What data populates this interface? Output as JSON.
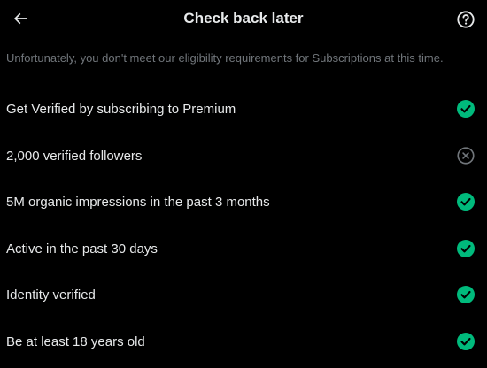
{
  "header": {
    "title": "Check back later",
    "back_icon": "arrow-left-icon",
    "help_icon": "question-circle-icon"
  },
  "subtitle": "Unfortunately, you don't meet our eligibility requirements for Subscriptions at this time.",
  "colors": {
    "background": "#000000",
    "text": "#e7e9ea",
    "muted": "#71767b",
    "met": "#00ba7c",
    "unmet": "#71767b"
  },
  "requirements": [
    {
      "label": "Get Verified by subscribing to Premium",
      "status": "met",
      "icon": "check-circle-icon"
    },
    {
      "label": "2,000 verified followers",
      "status": "unmet",
      "icon": "x-circle-icon"
    },
    {
      "label": "5M organic impressions in the past 3 months",
      "status": "met",
      "icon": "check-circle-icon"
    },
    {
      "label": "Active in the past 30 days",
      "status": "met",
      "icon": "check-circle-icon"
    },
    {
      "label": "Identity verified",
      "status": "met",
      "icon": "check-circle-icon"
    },
    {
      "label": "Be at least 18 years old",
      "status": "met",
      "icon": "check-circle-icon"
    }
  ]
}
